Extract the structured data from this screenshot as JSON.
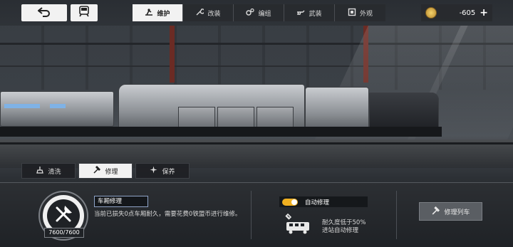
{
  "topbar": {
    "back_icon": "back-arrow-icon",
    "train_icon": "train-icon",
    "tabs": [
      {
        "label": "维护",
        "icon": "maintenance-icon",
        "active": true
      },
      {
        "label": "改装",
        "icon": "wrench-icon",
        "active": false
      },
      {
        "label": "编组",
        "icon": "gears-icon",
        "active": false
      },
      {
        "label": "武装",
        "icon": "weapon-icon",
        "active": false
      },
      {
        "label": "外观",
        "icon": "appearance-icon",
        "active": false
      }
    ],
    "currency": {
      "icon": "coin-icon",
      "amount": "-605",
      "add_label": "+"
    }
  },
  "subtabs": [
    {
      "label": "清洗",
      "icon": "brush-icon",
      "active": false
    },
    {
      "label": "修理",
      "icon": "hammer-icon",
      "active": true
    },
    {
      "label": "保养",
      "icon": "sparkle-icon",
      "active": false
    }
  ],
  "repair": {
    "section_title": "车厢修理",
    "durability": "7600/7600",
    "description": "当前已损失0点车厢耐久，需要花费0铁盟币进行维修。"
  },
  "auto_repair": {
    "label": "自动修理",
    "enabled": true,
    "description_line1": "耐久度低于50%",
    "description_line2": "进站自动修理"
  },
  "repair_train_button": "修理列车",
  "colors": {
    "accent": "#f0b021",
    "active_tab_bg": "#f2f2f2"
  }
}
